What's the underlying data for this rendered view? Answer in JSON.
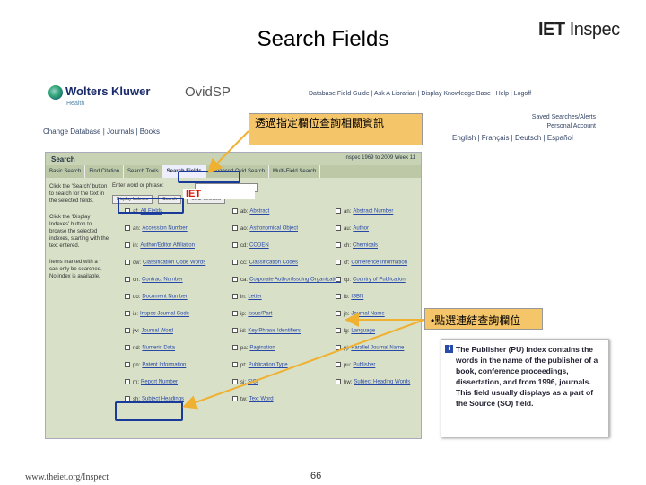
{
  "slide": {
    "title": "Search Fields",
    "logo_iet": "IET",
    "logo_inspec": "Inspec",
    "footer_url": "www.theiet.org/Inspect",
    "page_number": "66"
  },
  "header": {
    "brand": "Wolters Kluwer",
    "brand_sub": "Health",
    "product": "OvidSP",
    "topnav": "Database Field Guide | Ask A Librarian | Display Knowledge Base | Help | Logoff",
    "subnav": "Change Database | Journals | Books",
    "right_links": [
      "Saved Searches/Alerts",
      "Personal Account"
    ],
    "languages": "English | Français | Deutsch | Español"
  },
  "panel": {
    "title": "Search",
    "database": "Inspec 1969 to 2009 Week 11",
    "tabs": [
      "Basic Search",
      "Find Citation",
      "Search Tools",
      "Search Fields",
      "Advanced Ovid Search",
      "Multi-Field Search"
    ],
    "search_label": "Enter word or phrase:",
    "search_value": "IET",
    "buttons": [
      "Display Indexes",
      "Search",
      "Clear Selected"
    ],
    "help": [
      "Click the 'Search' button to search for the text in the selected fields.",
      "Click the 'Display Indexes' button to browse the selected indexes, starting with the text entered.",
      "Items marked with a * can only be searched. No index is available."
    ],
    "fields": [
      {
        "abbr": "af:",
        "name": "All Fields"
      },
      {
        "abbr": "ab:",
        "name": "Abstract"
      },
      {
        "abbr": "an:",
        "name": "Abstract Number"
      },
      {
        "abbr": "an:",
        "name": "Accession Number"
      },
      {
        "abbr": "ao:",
        "name": "Astronomical Object"
      },
      {
        "abbr": "au:",
        "name": "Author"
      },
      {
        "abbr": "in:",
        "name": "Author/Editor Affiliation"
      },
      {
        "abbr": "cd:",
        "name": "CODEN"
      },
      {
        "abbr": "ch:",
        "name": "Chemicals"
      },
      {
        "abbr": "cw:",
        "name": "Classification Code Words"
      },
      {
        "abbr": "cc:",
        "name": "Classification Codes"
      },
      {
        "abbr": "cf:",
        "name": "Conference Information"
      },
      {
        "abbr": "cn:",
        "name": "Contract Number"
      },
      {
        "abbr": "ca:",
        "name": "Corporate Author/Issuing Organization"
      },
      {
        "abbr": "cp:",
        "name": "Country of Publication"
      },
      {
        "abbr": "do:",
        "name": "Document Number"
      },
      {
        "abbr": "ln:",
        "name": "Letter"
      },
      {
        "abbr": "ib:",
        "name": "ISBN"
      },
      {
        "abbr": "is:",
        "name": "Inspec Journal Code"
      },
      {
        "abbr": "ip:",
        "name": "Issue/Part"
      },
      {
        "abbr": "jn:",
        "name": "Journal Name"
      },
      {
        "abbr": "jw:",
        "name": "Journal Word"
      },
      {
        "abbr": "id:",
        "name": "Key Phrase Identifiers"
      },
      {
        "abbr": "lg:",
        "name": "Language"
      },
      {
        "abbr": "nd:",
        "name": "Numeric Data"
      },
      {
        "abbr": "pa:",
        "name": "Pagination"
      },
      {
        "abbr": "pj:",
        "name": "Parallel Journal Name"
      },
      {
        "abbr": "pn:",
        "name": "Patent Information"
      },
      {
        "abbr": "pt:",
        "name": "Publication Type"
      },
      {
        "abbr": "pu:",
        "name": "Publisher"
      },
      {
        "abbr": "rn:",
        "name": "Report Number"
      },
      {
        "abbr": "si:",
        "name": "SICI"
      },
      {
        "abbr": "hw:",
        "name": "Subject Heading Words"
      },
      {
        "abbr": "sh:",
        "name": "Subject Headings"
      },
      {
        "abbr": "tw:",
        "name": "Text Word"
      }
    ]
  },
  "popup": {
    "icon": "info-icon",
    "text": "The Publisher (PU) Index contains the words in the name of the publisher of a book, conference proceedings, dissertation, and from 1996, journals. This field usually displays as a part of the Source (SO) field."
  },
  "callouts": {
    "top": "透過指定欄位查詢相關資訊",
    "right": "•點選連結查詢欄位"
  },
  "colors": {
    "callout_bg": "#f5c56a",
    "highlight_border": "#1a3a9a",
    "arrow": "#f0b030",
    "link": "#2848a8",
    "accent_red": "#dd1100"
  }
}
